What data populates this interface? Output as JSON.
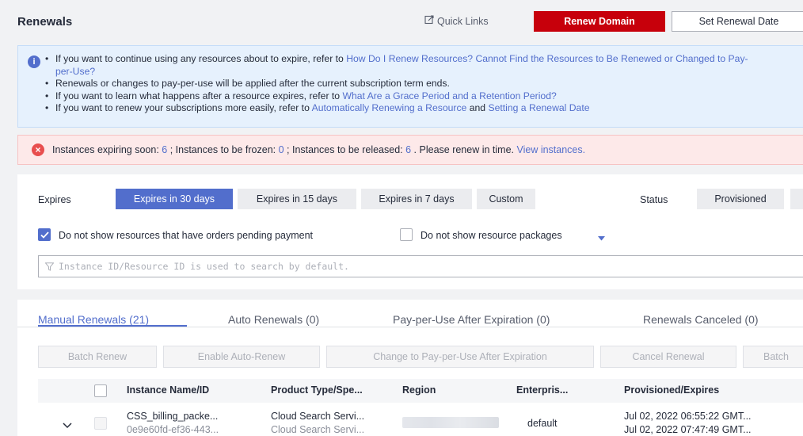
{
  "header": {
    "title": "Renewals",
    "quick_links": "Quick Links",
    "renew_domain": "Renew Domain",
    "set_renewal_date": "Set Renewal Date"
  },
  "info": {
    "line1_prefix": "If you want to continue using any resources about to expire, refer to ",
    "line1_link": "How Do I Renew Resources? Cannot Find the Resources to Be Renewed or Changed to Pay-",
    "line1_cont": "per-Use?",
    "line2": "Renewals or changes to pay-per-use will be applied after the current subscription term ends.",
    "line3_prefix": "If you want to learn what happens after a resource expires, refer to ",
    "line3_link": "What Are a Grace Period and a Retention Period?",
    "line4_prefix": "If you want to renew your subscriptions more easily, refer to ",
    "line4_link1": "Automatically Renewing a Resource",
    "line4_mid": " and ",
    "line4_link2": "Setting a Renewal Date"
  },
  "alert": {
    "expiring_label": "Instances expiring soon: ",
    "expiring_count": "6",
    "frozen_label": " ; Instances to be frozen: ",
    "frozen_count": "0",
    "released_label": " ; Instances to be released: ",
    "released_count": "6",
    "suffix": " . Please renew in time. ",
    "view_link": "View instances."
  },
  "filters": {
    "expires_label": "Expires",
    "expires_options": [
      "Expires in 30 days",
      "Expires in 15 days",
      "Expires in 7 days",
      "Custom"
    ],
    "status_label": "Status",
    "status_option": "Provisioned",
    "chk_pending": "Do not show resources that have orders pending payment",
    "chk_packages": "Do not show resource packages",
    "search_placeholder": "Instance ID/Resource ID is used to search by default."
  },
  "tabs": [
    "Manual Renewals (21)",
    "Auto Renewals (0)",
    "Pay-per-Use After Expiration (0)",
    "Renewals Canceled (0)"
  ],
  "actions": [
    "Batch Renew",
    "Enable Auto-Renew",
    "Change to Pay-per-Use After Expiration",
    "Cancel Renewal",
    "Batch"
  ],
  "table": {
    "columns": [
      "Instance Name/ID",
      "Product Type/Spe...",
      "Region",
      "Enterpris...",
      "Provisioned/Expires"
    ],
    "rows": [
      {
        "name": "CSS_billing_packe...",
        "id": "0e9e60fd-ef36-443...",
        "product": "Cloud Search Servi...",
        "spec": "Cloud Search Servi...",
        "enterprise": "default",
        "provisioned": "Jul 02, 2022 06:55:22 GMT...",
        "expires": "Jul 02, 2022 07:47:49 GMT..."
      }
    ]
  },
  "colors": {
    "accent": "#526ecc",
    "danger": "#c7000b"
  }
}
